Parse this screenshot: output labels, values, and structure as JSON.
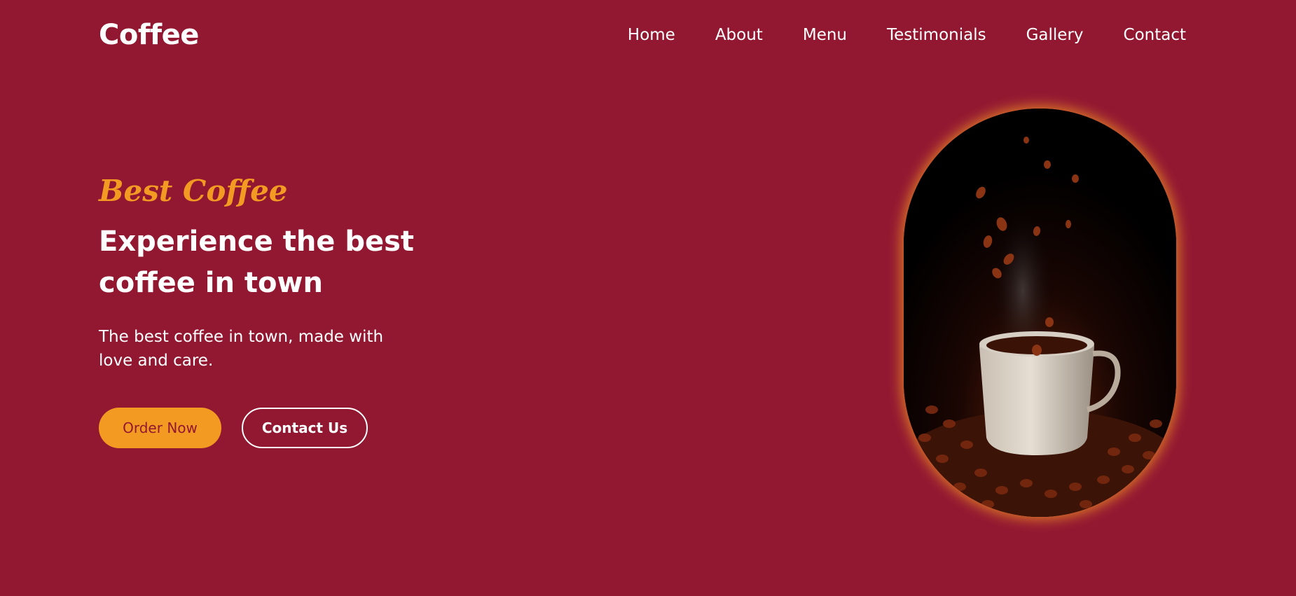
{
  "brand": {
    "logo": "Coffee"
  },
  "nav": {
    "items": [
      {
        "label": "Home"
      },
      {
        "label": "About"
      },
      {
        "label": "Menu"
      },
      {
        "label": "Testimonials"
      },
      {
        "label": "Gallery"
      },
      {
        "label": "Contact"
      }
    ]
  },
  "hero": {
    "tagline": "Best Coffee",
    "headline_line1": "Experience the best",
    "headline_line2": "coffee in town",
    "subtext": "The best coffee in town, made with love and care.",
    "primary_button": "Order Now",
    "secondary_button": "Contact Us",
    "image_alt": "coffee cup with beans"
  },
  "colors": {
    "background": "#921832",
    "accent": "#f39a22",
    "text": "#ffffff"
  }
}
